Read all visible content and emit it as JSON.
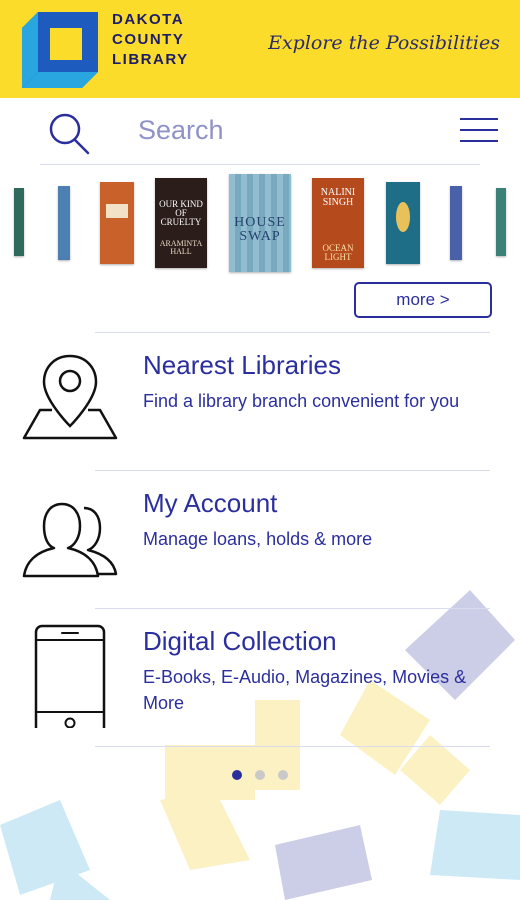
{
  "header": {
    "logo_lines": [
      "DAKOTA",
      "COUNTY",
      "LIBRARY"
    ],
    "tagline": "Explore the Possibilities"
  },
  "search": {
    "placeholder": "Search"
  },
  "carousel": {
    "books": [
      {
        "title": "",
        "color": "#2f6a5c"
      },
      {
        "title": "",
        "color": "#4d7fb3"
      },
      {
        "title": "",
        "color": "#c8622a"
      },
      {
        "title": "OUR KIND OF CRUELTY",
        "author": "ARAMINTA HALL",
        "color": "#2a1d1a"
      },
      {
        "title": "HOUSE SWAP",
        "color": "#7fb2c9"
      },
      {
        "title": "NALINI SINGH",
        "subtitle": "OCEAN LIGHT",
        "color": "#b54a1d"
      },
      {
        "title": "",
        "color": "#1f6e88"
      },
      {
        "title": "",
        "color": "#4961a8"
      },
      {
        "title": "",
        "color": "#3b8177"
      }
    ],
    "more_label": "more >"
  },
  "items": [
    {
      "title": "Nearest Libraries",
      "subtitle": "Find a library branch convenient for you",
      "icon": "map-pin-icon"
    },
    {
      "title": "My Account",
      "subtitle": "Manage loans, holds & more",
      "icon": "users-icon"
    },
    {
      "title": "Digital Collection",
      "subtitle": "E-Books, E-Audio, Magazines, Movies & More",
      "icon": "phone-icon"
    }
  ],
  "pagination": {
    "pages": 3,
    "active": 1
  },
  "colors": {
    "brand_yellow": "#fbdc2a",
    "brand_blue": "#2b2f9e",
    "logo_blue": "#1e5bbf",
    "logo_cyan": "#29a6e0"
  }
}
